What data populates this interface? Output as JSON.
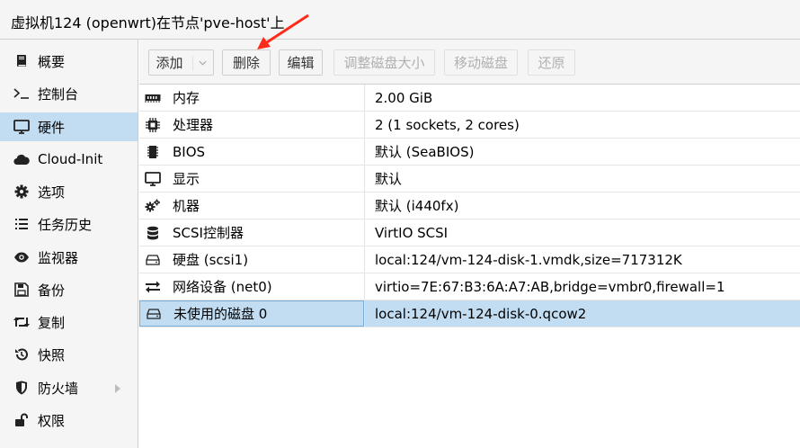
{
  "title": "虚拟机124 (openwrt)在节点'pve-host'上",
  "sidebar": {
    "items": [
      {
        "label": "概要",
        "icon": "book-icon"
      },
      {
        "label": "控制台",
        "icon": "terminal-icon"
      },
      {
        "label": "硬件",
        "icon": "monitor-icon",
        "active": true
      },
      {
        "label": "Cloud-Init",
        "icon": "cloud-icon"
      },
      {
        "label": "选项",
        "icon": "gear-icon"
      },
      {
        "label": "任务历史",
        "icon": "list-icon"
      },
      {
        "label": "监视器",
        "icon": "eye-icon"
      },
      {
        "label": "备份",
        "icon": "floppy-icon"
      },
      {
        "label": "复制",
        "icon": "retweet-icon"
      },
      {
        "label": "快照",
        "icon": "history-icon"
      },
      {
        "label": "防火墙",
        "icon": "shield-icon"
      },
      {
        "label": "权限",
        "icon": "unlock-icon"
      }
    ]
  },
  "toolbar": {
    "add_label": "添加",
    "remove_label": "删除",
    "edit_label": "编辑",
    "resize_label": "调整磁盘大小",
    "move_label": "移动磁盘",
    "revert_label": "还原"
  },
  "hardware": {
    "rows": [
      {
        "key": "内存",
        "value": "2.00 GiB",
        "icon": "memory-icon"
      },
      {
        "key": "处理器",
        "value": "2 (1 sockets, 2 cores)",
        "icon": "cpu-icon"
      },
      {
        "key": "BIOS",
        "value": "默认 (SeaBIOS)",
        "icon": "microchip-icon"
      },
      {
        "key": "显示",
        "value": "默认",
        "icon": "desktop-icon"
      },
      {
        "key": "机器",
        "value": "默认 (i440fx)",
        "icon": "cogs-icon"
      },
      {
        "key": "SCSI控制器",
        "value": "VirtIO SCSI",
        "icon": "database-icon"
      },
      {
        "key": "硬盘 (scsi1)",
        "value": "local:124/vm-124-disk-1.vmdk,size=717312K",
        "icon": "hdd-icon"
      },
      {
        "key": "网络设备 (net0)",
        "value": "virtio=7E:67:B3:6A:A7:AB,bridge=vmbr0,firewall=1",
        "icon": "exchange-icon"
      },
      {
        "key": "未使用的磁盘 0",
        "value": "local:124/vm-124-disk-0.qcow2",
        "icon": "hdd-icon",
        "selected": true
      }
    ]
  },
  "colors": {
    "selection": "#c2ddf2",
    "annotation_arrow": "#ff2a1a"
  }
}
